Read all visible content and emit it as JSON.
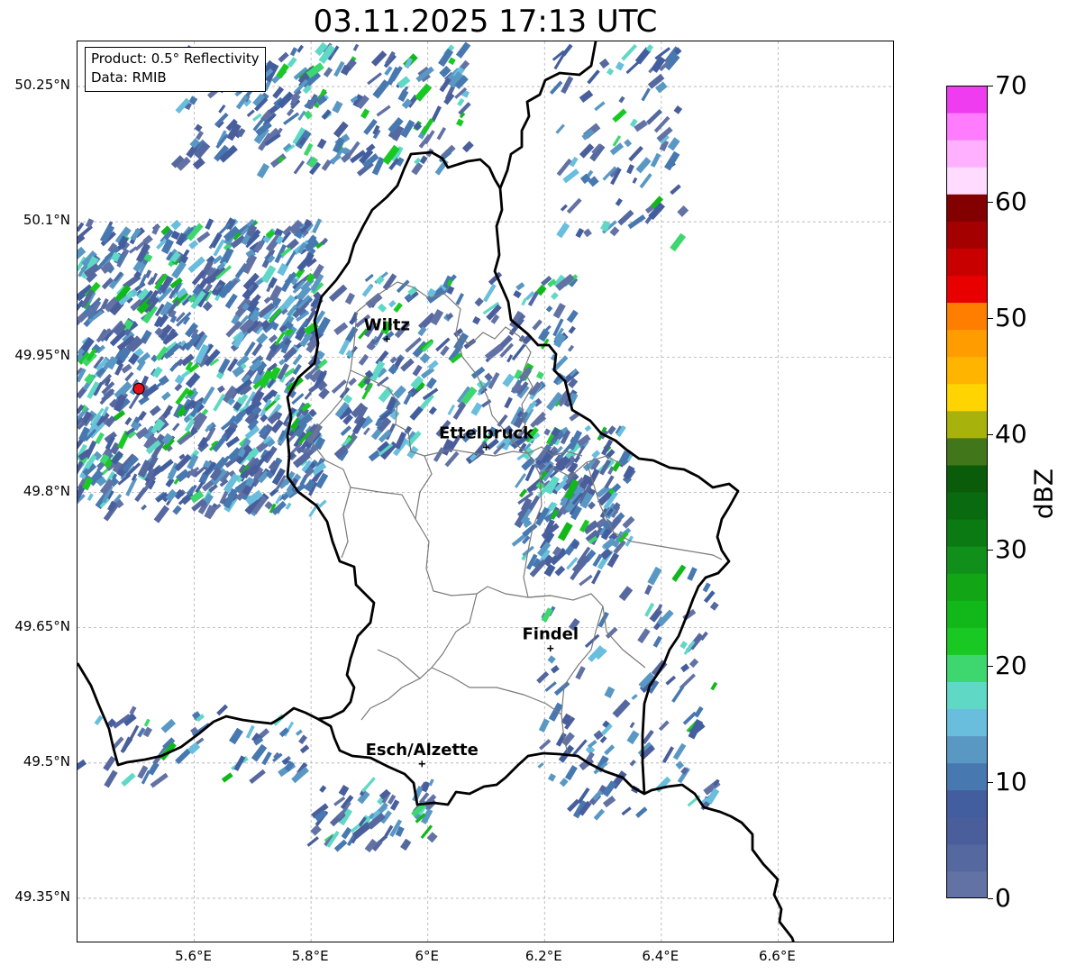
{
  "title": "03.11.2025 17:13 UTC",
  "info": {
    "product": "Product: 0.5° Reflectivity",
    "source": "Data: RMIB"
  },
  "map": {
    "lon_range": [
      5.4,
      6.8
    ],
    "lat_range": [
      49.3,
      50.3
    ],
    "lat_ticks": [
      {
        "value": 50.25,
        "label": "50.25°N"
      },
      {
        "value": 50.1,
        "label": "50.1°N"
      },
      {
        "value": 49.95,
        "label": "49.95°N"
      },
      {
        "value": 49.8,
        "label": "49.8°N"
      },
      {
        "value": 49.65,
        "label": "49.65°N"
      },
      {
        "value": 49.5,
        "label": "49.5°N"
      },
      {
        "value": 49.35,
        "label": "49.35°N"
      }
    ],
    "lon_ticks": [
      {
        "value": 5.6,
        "label": "5.6°E"
      },
      {
        "value": 5.8,
        "label": "5.8°E"
      },
      {
        "value": 6.0,
        "label": "6°E"
      },
      {
        "value": 6.2,
        "label": "6.2°E"
      },
      {
        "value": 6.4,
        "label": "6.4°E"
      },
      {
        "value": 6.6,
        "label": "6.6°E"
      }
    ],
    "cities": [
      {
        "name": "Wiltz",
        "lon": 5.93,
        "lat": 49.97
      },
      {
        "name": "Ettelbruck",
        "lon": 6.1,
        "lat": 49.85
      },
      {
        "name": "Findel",
        "lon": 6.21,
        "lat": 49.627
      },
      {
        "name": "Esch/Alzette",
        "lon": 5.99,
        "lat": 49.499
      }
    ],
    "radar_site": {
      "lon": 5.505,
      "lat": 49.915,
      "color": "#e8101a"
    }
  },
  "colorbar": {
    "label": "dBZ",
    "min": 0,
    "max": 70,
    "step": 2.5,
    "ticks": [
      "0",
      "10",
      "20",
      "30",
      "40",
      "50",
      "60",
      "70"
    ],
    "colors": [
      "#6272a4",
      "#55689f",
      "#4a5e9c",
      "#425e9e",
      "#4878b0",
      "#5a98c4",
      "#68bedc",
      "#60d8c6",
      "#3ed66e",
      "#1ac823",
      "#12b81a",
      "#12a515",
      "#10901a",
      "#0c7a12",
      "#0a6a10",
      "#0a5c0a",
      "#42761a",
      "#a8b20c",
      "#ffd400",
      "#ffb400",
      "#ff9c00",
      "#ff7e00",
      "#e80000",
      "#c80000",
      "#a40000",
      "#820000",
      "#ffdcff",
      "#ffb0ff",
      "#ff7cff",
      "#f03cf0"
    ]
  }
}
